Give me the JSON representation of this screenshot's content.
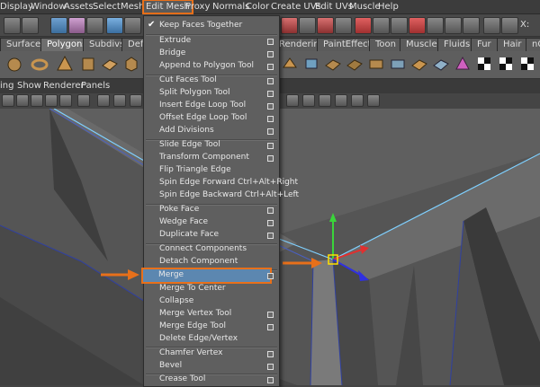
{
  "menubar": {
    "items": [
      "Display",
      "Window",
      "Assets",
      "Select",
      "Mesh",
      "Edit Mesh",
      "Proxy",
      "Normals",
      "Color",
      "Create UVs",
      "Edit UVs",
      "Muscle",
      "Help"
    ],
    "active": "Edit Mesh"
  },
  "toolbar": {
    "field_label": "X:"
  },
  "shelf_tabs": [
    "Surfaces",
    "Polygons",
    "Subdivs",
    "Defo",
    "Rendering",
    "PaintEffects",
    "Toon",
    "Muscle",
    "Fluids",
    "Fur",
    "Hair",
    "nC"
  ],
  "shelf_tab_active": "Polygons",
  "panel_menu": [
    "ing",
    "Show",
    "Renderer",
    "Panels"
  ],
  "edit_mesh_menu": {
    "items": [
      {
        "label": "Keep Faces Together",
        "checked": true,
        "option_box": false
      },
      {
        "label": "Extrude",
        "option_box": true
      },
      {
        "label": "Bridge",
        "option_box": true
      },
      {
        "label": "Append to Polygon Tool",
        "option_box": true
      },
      {
        "label": "Cut Faces Tool",
        "option_box": true
      },
      {
        "label": "Split Polygon Tool",
        "option_box": true
      },
      {
        "label": "Insert Edge Loop Tool",
        "option_box": true
      },
      {
        "label": "Offset Edge Loop Tool",
        "option_box": true
      },
      {
        "label": "Add Divisions",
        "option_box": true
      },
      {
        "label": "Slide Edge Tool",
        "option_box": true
      },
      {
        "label": "Transform Component",
        "option_box": true
      },
      {
        "label": "Flip Triangle Edge",
        "option_box": false
      },
      {
        "label": "Spin Edge Forward  Ctrl+Alt+Right",
        "option_box": false
      },
      {
        "label": "Spin Edge Backward  Ctrl+Alt+Left",
        "option_box": false
      },
      {
        "label": "Poke Face",
        "option_box": true
      },
      {
        "label": "Wedge Face",
        "option_box": true
      },
      {
        "label": "Duplicate Face",
        "option_box": true
      },
      {
        "label": "Connect Components",
        "option_box": false
      },
      {
        "label": "Detach Component",
        "option_box": false
      },
      {
        "label": "Merge",
        "option_box": true,
        "highlighted": true
      },
      {
        "label": "Merge To Center",
        "option_box": false
      },
      {
        "label": "Collapse",
        "option_box": false
      },
      {
        "label": "Merge Vertex Tool",
        "option_box": true
      },
      {
        "label": "Merge Edge Tool",
        "option_box": true
      },
      {
        "label": "Delete Edge/Vertex",
        "option_box": false
      },
      {
        "label": "Chamfer Vertex",
        "option_box": true
      },
      {
        "label": "Bevel",
        "option_box": true
      },
      {
        "label": "Crease Tool",
        "option_box": true
      }
    ]
  },
  "colors": {
    "highlight": "#5c87b0",
    "annotation_arrow": "#e8701a",
    "mesh_wire": "#7fd0ff"
  }
}
